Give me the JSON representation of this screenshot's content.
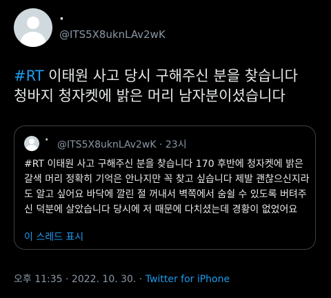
{
  "author": {
    "name": "·",
    "handle": "@ITS5X8uknLAv2wK"
  },
  "tweet": {
    "hashtag": "#RT",
    "line1": " 이태원 사고 당시 구해주신 분을 찾습니다",
    "line2": "청바지 청자켓에 밝은 머리 남자분이셨습니다"
  },
  "quote": {
    "name": "·",
    "handle": "@ITS5X8uknLAv2wK",
    "time": " · 23시",
    "text": "#RT 이태원 사고 구해주신 분을 찾습니다 170 후반에 청자켓에 밝은 갈색 머리 정확히 기억은 안나지만 꼭 찾고 싶습니다 제발 괜찮으신지라도 알고 싶어요 바닥에 깔린 절 꺼내서 벽쪽에서 숨쉴 수 있도록 버텨주신 덕분에 살았습니다 당시에 저 때문에 다치셨는데 경황이 없었어요",
    "thread_link": "이 스레드 표시"
  },
  "meta": {
    "timestamp": "오후 11:35 · 2022. 10. 30. · ",
    "source": "Twitter for iPhone"
  }
}
